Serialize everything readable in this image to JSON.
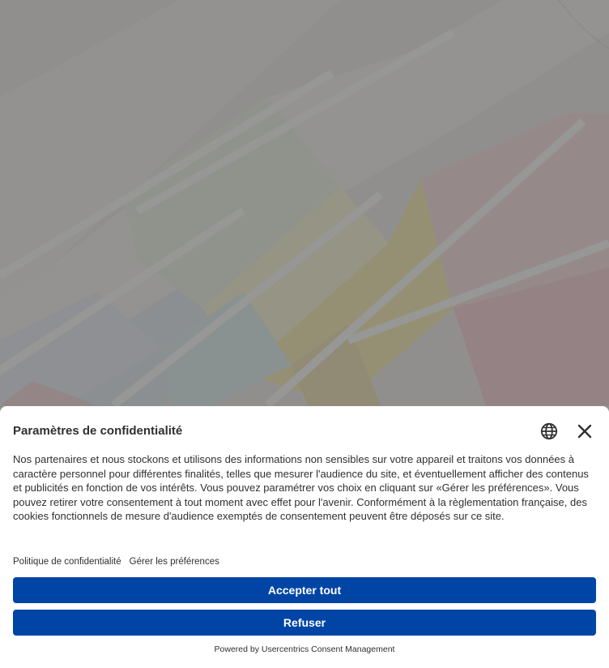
{
  "consent": {
    "title": "Paramètres de confidentialité",
    "description": "Nos partenaires et nous stockons et utilisons des informations non sensibles sur votre appareil et traitons vos données à caractère personnel pour différentes finalités, telles que mesurer l'audience du site, et éventuellement afficher des contenus et publicités en fonction de vos intérêts. Vous pouvez paramétrer vos choix en cliquant sur «Gérer les préférences». Vous pouvez retirer votre consentement à tout moment avec effet pour l'avenir. Conformément à la règlementation française, des cookies fonctionnels de mesure d'audience exemptés de consentement peuvent être déposés sur ce site.",
    "links": {
      "privacy_policy": "Politique de confidentialité",
      "manage_preferences": "Gérer les préférences"
    },
    "buttons": {
      "accept_all": "Accepter tout",
      "refuse": "Refuser"
    },
    "powered_by": "Powered by Usercentrics Consent Management",
    "icons": {
      "language": "globe-icon",
      "close": "close-icon"
    }
  },
  "colors": {
    "primary_button": "#0045a5",
    "banner_background": "#ffffff",
    "text": "#303030",
    "overlay": "rgba(80,80,80,0.58)"
  }
}
